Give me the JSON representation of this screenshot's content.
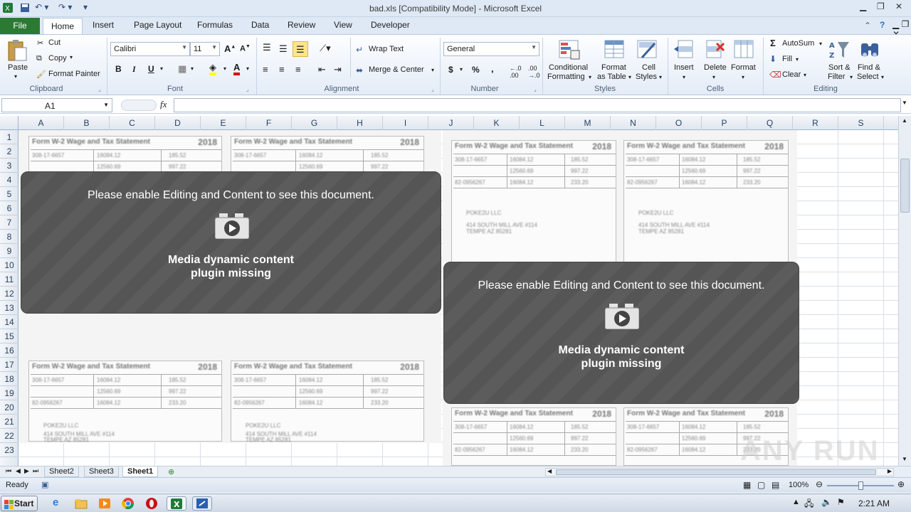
{
  "window": {
    "title": "bad.xls  [Compatibility Mode]  -  Microsoft Excel"
  },
  "ribbon_tabs": [
    "File",
    "Home",
    "Insert",
    "Page Layout",
    "Formulas",
    "Data",
    "Review",
    "View",
    "Developer"
  ],
  "clipboard": {
    "paste": "Paste",
    "cut": "Cut",
    "copy": "Copy",
    "format_painter": "Format Painter",
    "label": "Clipboard"
  },
  "font": {
    "name": "Calibri",
    "size": "11",
    "label": "Font"
  },
  "alignment": {
    "wrap": "Wrap Text",
    "merge": "Merge & Center",
    "label": "Alignment"
  },
  "number": {
    "format": "General",
    "label": "Number"
  },
  "styles": {
    "conditional_1": "Conditional",
    "conditional_2": "Formatting",
    "format_table_1": "Format",
    "format_table_2": "as Table",
    "cell_styles_1": "Cell",
    "cell_styles_2": "Styles",
    "label": "Styles"
  },
  "cells": {
    "insert": "Insert",
    "delete": "Delete",
    "format": "Format",
    "label": "Cells"
  },
  "editing": {
    "autosum": "AutoSum",
    "fill": "Fill",
    "clear": "Clear",
    "sort_1": "Sort &",
    "sort_2": "Filter",
    "find_1": "Find &",
    "find_2": "Select",
    "label": "Editing"
  },
  "formula_bar": {
    "name_box": "A1",
    "fx": "fx"
  },
  "columns": [
    "A",
    "B",
    "C",
    "D",
    "E",
    "F",
    "G",
    "H",
    "I",
    "J",
    "K",
    "L",
    "M",
    "N",
    "O",
    "P",
    "Q",
    "R",
    "S"
  ],
  "rows": [
    "1",
    "2",
    "3",
    "4",
    "5",
    "6",
    "7",
    "8",
    "9",
    "10",
    "11",
    "12",
    "13",
    "14",
    "15",
    "16",
    "17",
    "18",
    "19",
    "20",
    "21",
    "22",
    "23"
  ],
  "form": {
    "title": "Form W-2 Wage and Tax Statement",
    "year": "2018",
    "ein": "308-17-6657",
    "wages": "16084.12",
    "fed_tax": "185.52",
    "ss_wages": "12560.69",
    "ss_tax": "997.22",
    "control": "82-0956267",
    "medicare_wages": "16084.12",
    "medicare_tax": "233.20",
    "company": "POKE2U LLC",
    "address1": "414 SOUTH MILL AVE #114",
    "address2": "TEMPE AZ 85281",
    "state": "AZ"
  },
  "banners": [
    {
      "message": "Please enable Editing and Content to see this document.",
      "line1": "Media dynamic content",
      "line2": "plugin missing"
    },
    {
      "message": "Please enable Editing and Content to see this document.",
      "line1": "Media dynamic content",
      "line2": "plugin missing"
    }
  ],
  "sheet_tabs": [
    "Sheet2",
    "Sheet3",
    "Sheet1"
  ],
  "active_sheet": "Sheet1",
  "status": {
    "ready": "Ready",
    "zoom": "100%"
  },
  "taskbar": {
    "start": "Start",
    "clock": "2:21 AM"
  },
  "watermark": "ANY RUN"
}
